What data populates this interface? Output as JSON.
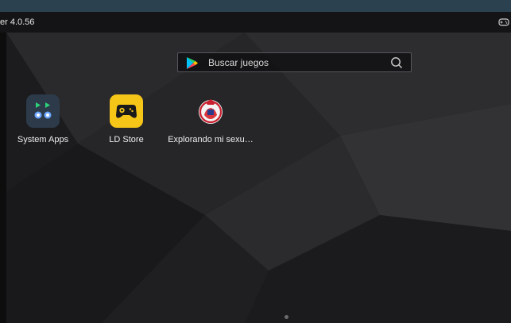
{
  "window": {
    "title": "er 4.0.56",
    "gamepad_icon": "gamepad-icon"
  },
  "search": {
    "placeholder": "Buscar juegos",
    "store_icon": "play-store-icon",
    "search_icon": "magnifier-icon"
  },
  "apps": [
    {
      "label": "System Apps",
      "icon": "system-apps-folder-icon"
    },
    {
      "label": "LD Store",
      "icon": "ld-store-gamepad-icon"
    },
    {
      "label": "Explorando mi sexu…",
      "icon": "explorando-app-logo-icon"
    }
  ],
  "colors": {
    "titlebar": "#141416",
    "top_strip": "#2b4150",
    "ld_store_yellow": "#f5c518",
    "folder_bg": "#2c3a4a"
  }
}
